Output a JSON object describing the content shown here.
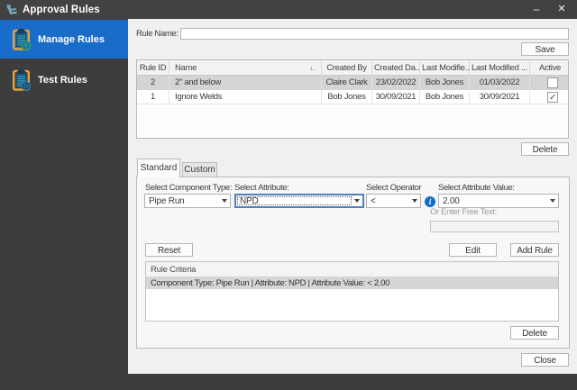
{
  "window": {
    "title": "Approval Rules",
    "minimize_glyph": "–",
    "close_glyph": "✕"
  },
  "sidebar": {
    "items": [
      {
        "label": "Manage Rules",
        "selected": true,
        "icon": "clipboard-add"
      },
      {
        "label": "Test Rules",
        "selected": false,
        "icon": "clipboard-play"
      }
    ]
  },
  "rule_form": {
    "rule_name_label": "Rule Name:",
    "rule_name_value": "",
    "save_label": "Save",
    "delete_label": "Delete"
  },
  "rules_table": {
    "headers": [
      "Rule ID",
      "Name",
      "Created By",
      "Created Da...",
      "Last Modifie...",
      "Last Modified ...",
      "Active"
    ],
    "rows": [
      {
        "rule_id": "2",
        "name": "2\" and below",
        "created_by": "Claire Clark",
        "created_date": "23/02/2022",
        "last_modified_by": "Bob Jones",
        "last_modified_date": "01/03/2022",
        "active": "",
        "selected": true
      },
      {
        "rule_id": "1",
        "name": "Ignore Welds",
        "created_by": "Bob Jones",
        "created_date": "30/09/2021",
        "last_modified_by": "Bob Jones",
        "last_modified_date": "30/09/2021",
        "active": "✓",
        "selected": false
      }
    ]
  },
  "tabs": [
    {
      "label": "Standard",
      "active": true
    },
    {
      "label": "Custom",
      "active": false
    }
  ],
  "criteria_form": {
    "component_type_label": "Select Component Type:",
    "component_type_value": "Pipe Run",
    "attribute_label": "Select Attribute:",
    "attribute_value": "NPD",
    "operator_label": "Select Operator",
    "operator_value": "<",
    "info_glyph": "i",
    "attribute_value_label": "Select Attribute Value:",
    "attribute_value_value": "2.00",
    "free_text_label": "Or Enter Free Text:",
    "free_text_value": "",
    "reset_label": "Reset",
    "edit_label": "Edit",
    "add_rule_label": "Add Rule"
  },
  "criteria_list": {
    "header": "Rule Criteria",
    "items": [
      {
        "text": "Component Type: Pipe Run | Attribute: NPD | Attribute Value: < 2.00",
        "selected": true
      }
    ],
    "delete_label": "Delete"
  },
  "footer": {
    "close_label": "Close"
  },
  "colors": {
    "titlebar_bg": "#424242",
    "sidebar_bg": "#3d3d3d",
    "selected_item_bg": "#1a6cc9",
    "main_bg": "#f0f0f0",
    "panel_bg": "#f7f7f7",
    "selected_row_bg": "#d4d4d4",
    "focus_border": "#4d80bd",
    "info_icon_bg": "#0f6fc5",
    "clipboard_frame": "#e8a33d",
    "clipboard_paper": "#1d5677",
    "badge_green": "#2ba14f",
    "badge_blue": "#2079b8"
  }
}
